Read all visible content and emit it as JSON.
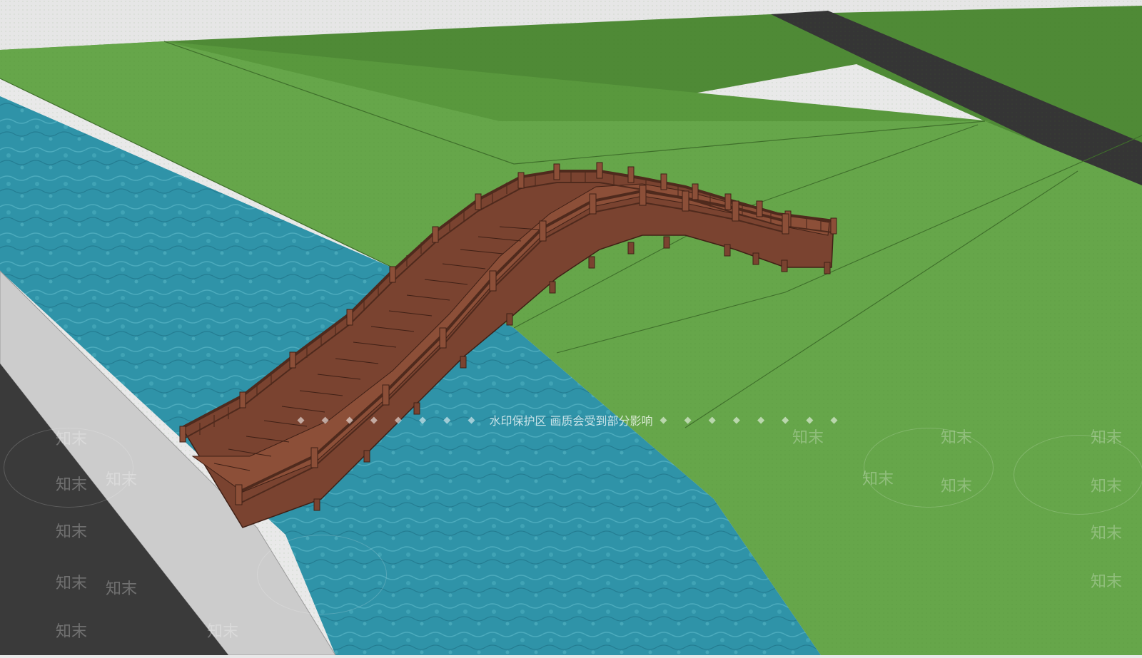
{
  "watermark": {
    "caption": "水印保护区   画质会受到部分影响",
    "dots": "◆ ◆ ◆ ◆ ◆ ◆ ◆ ◆",
    "logo_text": "知末"
  },
  "colors": {
    "sky": "#e6e6e6",
    "grass_light": "#66a64a",
    "grass_dark": "#4f8a36",
    "water": "#2f93a8",
    "road": "#3a3a3a",
    "sidewalk": "#c9c9c9",
    "wood": "#7a4330",
    "wood_dark": "#4f2a1d"
  }
}
